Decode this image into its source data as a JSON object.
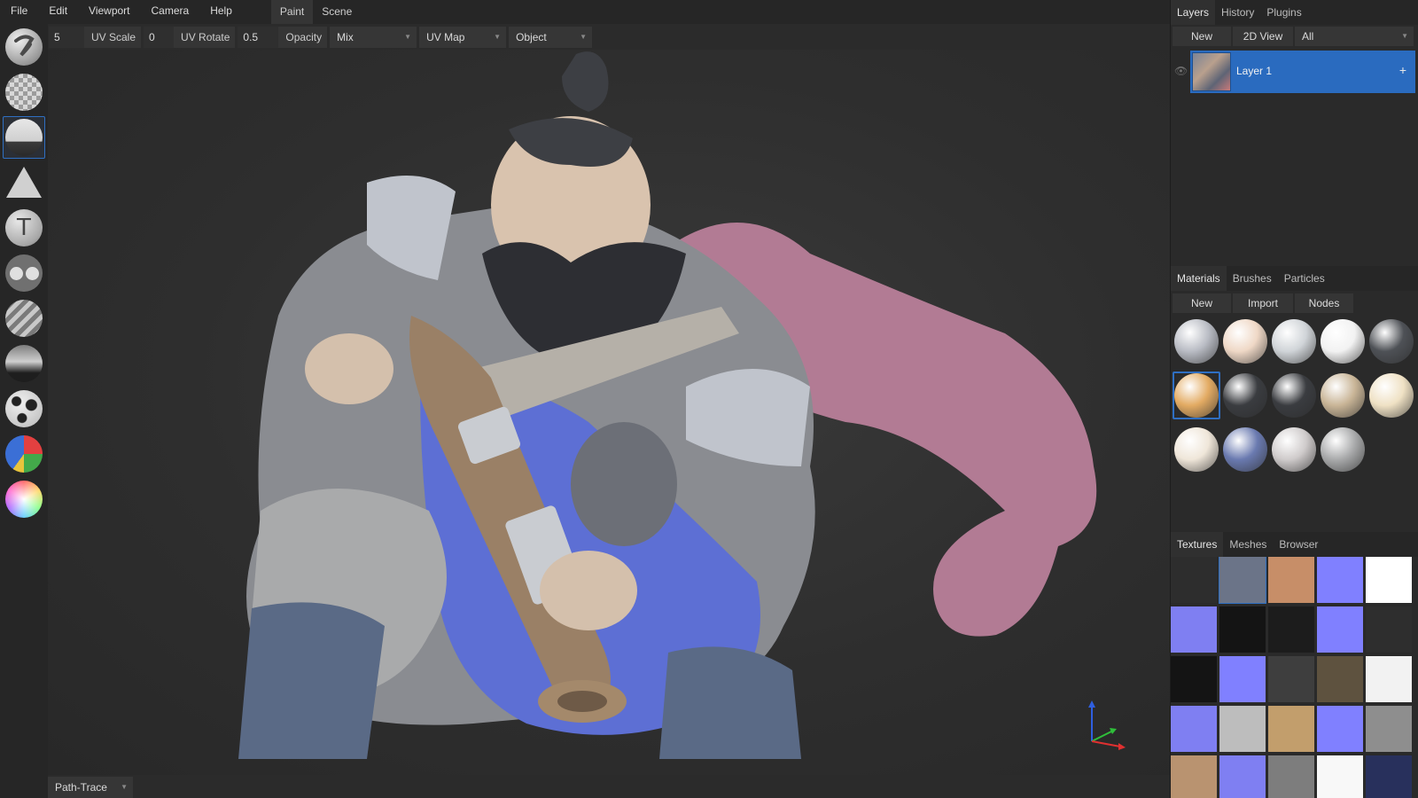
{
  "menubar": {
    "items": [
      "File",
      "Edit",
      "Viewport",
      "Camera",
      "Help"
    ],
    "workspace_tabs": [
      "Paint",
      "Scene"
    ]
  },
  "toolbar": {
    "uv_scale_value": "5",
    "uv_scale_label": "UV Scale",
    "uv_rotate_value": "0",
    "uv_rotate_label": "UV Rotate",
    "opacity_value": "0.5",
    "opacity_label": "Opacity",
    "blend_mode": "Mix",
    "uv_map": "UV Map",
    "space": "Object"
  },
  "tools": [
    "brush-tool",
    "eraser-tool",
    "fill-tool",
    "decal-tool",
    "text-tool",
    "clone-tool",
    "blur-tool",
    "smudge-tool",
    "particle-tool",
    "colorid-tool",
    "picker-tool"
  ],
  "status": {
    "render_mode": "Path-Trace"
  },
  "layers_panel": {
    "tabs": [
      "Layers",
      "History",
      "Plugins"
    ],
    "buttons": {
      "new": "New",
      "view2d": "2D View",
      "filter": "All"
    },
    "layers": [
      {
        "name": "Layer 1"
      }
    ]
  },
  "materials_panel": {
    "tabs": [
      "Materials",
      "Brushes",
      "Particles"
    ],
    "buttons": {
      "new": "New",
      "import": "Import",
      "nodes": "Nodes"
    },
    "swatches": [
      "#b9bcc4",
      "#efd8c6",
      "#d0d4d8",
      "#f2f2f2",
      "#4e5156",
      "#e3ab63",
      "#3a3c40",
      "#3a3c40",
      "#c9b597",
      "#efe1c4",
      "#efe6d9",
      "#6a7ab0",
      "#cfcbcb",
      "#a9aaab"
    ]
  },
  "textures_panel": {
    "tabs": [
      "Textures",
      "Meshes",
      "Browser"
    ],
    "swatches": [
      "#2d2d2d",
      "#6b7488",
      "#c78e68",
      "#8080ff",
      "#ffffff",
      "#7f7ff2",
      "#141414",
      "#1c1c1c",
      "#8080ff",
      "#2e2e2e",
      "#141414",
      "#8080ff",
      "#3e3e3e",
      "#5e523f",
      "#f2f2f2",
      "#7f7ff2",
      "#bdbdbd",
      "#c29e6c",
      "#8080ff",
      "#8e8e8e",
      "#b99370",
      "#7f7ff2",
      "#7d7d7d",
      "#f8f8f8",
      "#28305c"
    ]
  },
  "colors": {
    "accent": "#2f6fc2",
    "layer_selected": "#2a6bbf"
  }
}
